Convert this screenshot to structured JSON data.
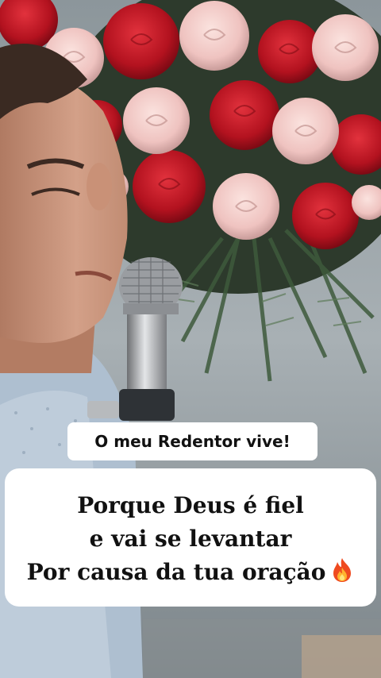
{
  "video": {
    "scene_icon": "singer-with-microphone-and-roses-photo"
  },
  "captions": {
    "title": "O meu Redentor vive!",
    "lines": [
      "Porque Deus é fiel",
      "e vai se levantar",
      "Por causa da tua oração"
    ],
    "emoji_icon": "fire-icon"
  }
}
